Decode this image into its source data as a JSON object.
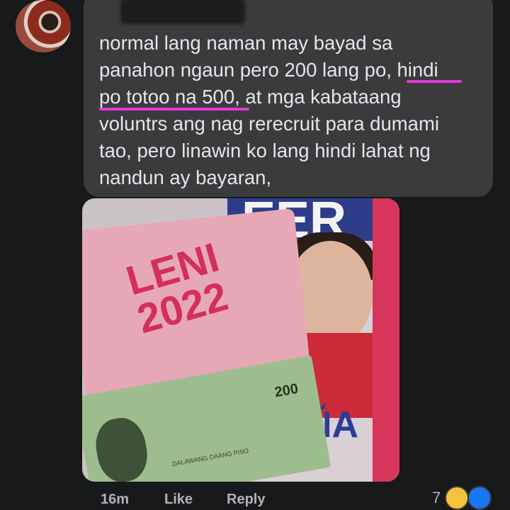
{
  "comment": {
    "text": "normal lang naman may bayad sa\npanahon ngaun pero 200 lang po, hindi\npo totoo na 500, at mga kabataang\nvoluntrs ang nag rerecruit para dumami\ntao, pero linawin ko lang hindi lahat ng\nnandun ay bayaran,",
    "highlight_color": "#e437d6"
  },
  "photo": {
    "shirt_text_line1": "LENI",
    "shirt_text_line2": "2022",
    "poster_text_top": "EER",
    "poster_text_bottom": "ÑA",
    "banknote_value": "200",
    "banknote_caption": "DALAWANG DAANG PISO"
  },
  "meta": {
    "time": "16m",
    "like": "Like",
    "reply": "Reply"
  },
  "reactions": {
    "count": "7",
    "icons": [
      "haha-icon",
      "like-icon"
    ]
  }
}
